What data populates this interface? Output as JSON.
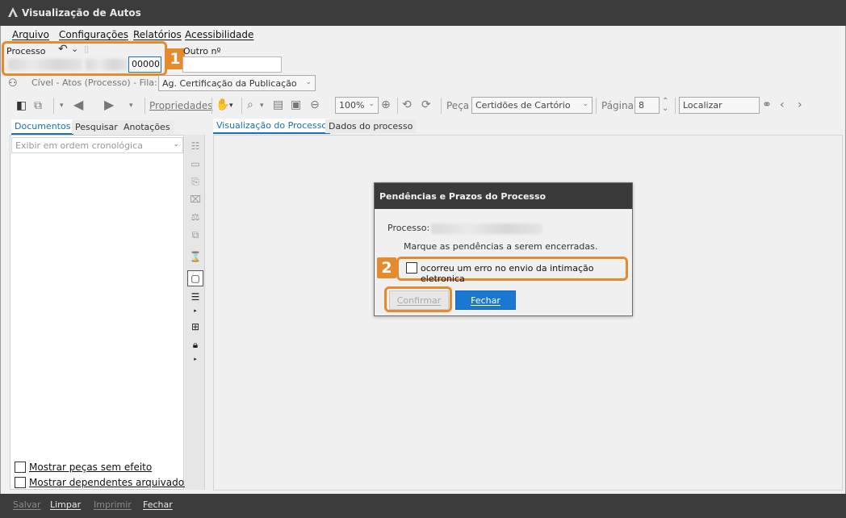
{
  "window": {
    "title": "Visualização de Autos"
  },
  "menu": [
    "Arquivo",
    "Configurações",
    "Relatórios",
    "Acessibilidade"
  ],
  "process": {
    "label": "Processo",
    "number_suffix": "00000",
    "other_label": "Outro nº",
    "other_value": ""
  },
  "callouts": {
    "first": "1",
    "second": "2"
  },
  "queue": {
    "text": "Cível - Atos (Processo) - Fila:",
    "selected": "Ag. Certificação da Publicação"
  },
  "toolbar": {
    "properties": "Propriedades",
    "zoom": "100%",
    "piece_label": "Peça",
    "piece_selected": "Certidões de Cartório",
    "page_label": "Página",
    "page_value": "8",
    "search_placeholder": "Localizar"
  },
  "left_tabs": [
    "Documentos",
    "Pesquisar",
    "Anotações"
  ],
  "main_tabs": [
    "Visualização do Processo",
    "Dados do processo"
  ],
  "order_select": "Exibir em ordem cronológica",
  "checkboxes": [
    "Mostrar peças sem efeito",
    "Mostrar dependentes arquivados"
  ],
  "dialog": {
    "title": "Pendências e Prazos do Processo",
    "process_label": "Processo:",
    "instruction": "Marque as pendências a serem encerradas.",
    "option": "ocorreu um erro no envio da intimação eletronica",
    "confirm": "Confirmar",
    "close": "Fechar"
  },
  "statusbar": [
    "Salvar",
    "Limpar",
    "Imprimir",
    "Fechar"
  ],
  "colors": {
    "accent": "#1a78d2",
    "callout": "#e68a2e",
    "chrome": "#3c3c3c"
  }
}
